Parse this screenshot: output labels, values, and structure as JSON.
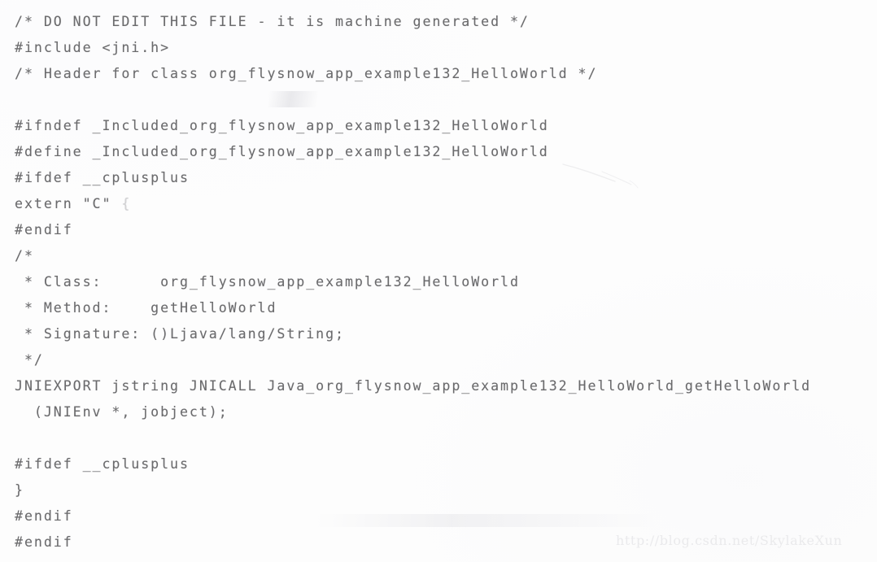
{
  "document": {
    "kind": "c-header-source-listing",
    "background_color": "#fdfdfd",
    "text_color": "#6a6a6c",
    "lines": [
      "/* DO NOT EDIT THIS FILE - it is machine generated */",
      "#include <jni.h>",
      "/* Header for class org_flysnow_app_example132_HelloWorld */",
      "",
      "#ifndef _Included_org_flysnow_app_example132_HelloWorld",
      "#define _Included_org_flysnow_app_example132_HelloWorld",
      "#ifdef __cplusplus",
      "extern \"C\" {",
      "#endif",
      "/*",
      " * Class:      org_flysnow_app_example132_HelloWorld",
      " * Method:    getHelloWorld",
      " * Signature: ()Ljava/lang/String;",
      " */",
      "JNIEXPORT jstring JNICALL Java_org_flysnow_app_example132_HelloWorld_getHelloWorld",
      "  (JNIEnv *, jobject);",
      "",
      "#ifdef __cplusplus",
      "}",
      "#endif",
      "#endif"
    ],
    "header_comment": {
      "do_not_edit": "/* DO NOT EDIT THIS FILE - it is machine generated */",
      "include_directive": "#include <jni.h>",
      "header_for_class": "/* Header for class org_flysnow_app_example132_HelloWorld */"
    },
    "include_guard": {
      "ifndef": "#ifndef _Included_org_flysnow_app_example132_HelloWorld",
      "define": "#define _Included_org_flysnow_app_example132_HelloWorld",
      "symbol": "_Included_org_flysnow_app_example132_HelloWorld",
      "endif": "#endif"
    },
    "cplusplus_guard": {
      "ifdef": "#ifdef __cplusplus",
      "extern_open": "extern \"C\" {",
      "extern_brace": "{",
      "extern_close_brace": "}",
      "endif": "#endif",
      "macro": "__cplusplus"
    },
    "method_comment": {
      "open": "/*",
      "class_label": " * Class:",
      "class_value": "org_flysnow_app_example132_HelloWorld",
      "method_label": " * Method:",
      "method_value": "getHelloWorld",
      "signature_label": " * Signature:",
      "signature_value": "()Ljava/lang/String;",
      "close": " */"
    },
    "function_declaration": {
      "export_macro": "JNIEXPORT",
      "return_type": "jstring",
      "call_convention": "JNICALL",
      "function_name": "Java_org_flysnow_app_example132_HelloWorld_getHelloWorld",
      "signature_line": "JNIEXPORT jstring JNICALL Java_org_flysnow_app_example132_HelloWorld_getHelloWorld",
      "parameters_line": "  (JNIEnv *, jobject);",
      "parameters": "(JNIEnv *, jobject);"
    }
  },
  "watermark": {
    "text": "http://blog.csdn.net/SkylakeXun",
    "color": "#eaeaec"
  }
}
